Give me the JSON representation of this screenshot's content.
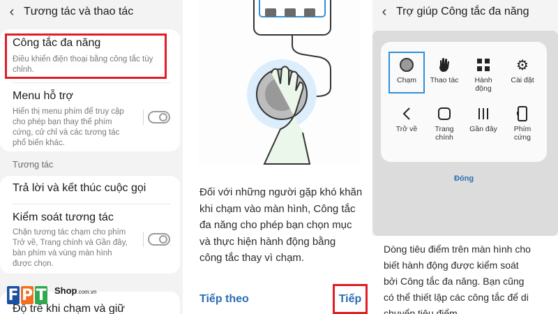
{
  "panel1": {
    "title": "Tương tác và thao tác",
    "items": [
      {
        "title": "Công tắc đa năng",
        "subtitle_lines": [
          "Điều khiển điện thoại bằng công tắc tùy",
          "chỉnh."
        ]
      },
      {
        "title": "Menu hỗ trợ",
        "subtitle_lines": [
          "Hiển thị menu phím để truy cập",
          "cho phép bạn thay thế phím",
          "cứng, cử chỉ và các tương tác",
          "phổ biến khác."
        ],
        "toggle": "off"
      },
      {
        "title": "Trả lời và kết thúc cuộc gọi"
      },
      {
        "title": "Kiểm soát tương tác",
        "subtitle_lines": [
          "Chặn tương tác chạm cho phím",
          "Trở về, Trang chính và Gần đây,",
          "bàn phím và vùng màn hình",
          "được chọn."
        ],
        "toggle": "off"
      },
      {
        "title": "Độ trễ khi chạm và giữ"
      }
    ],
    "section_label": "Tương tác",
    "logo": {
      "letters": [
        "F",
        "P",
        "T"
      ],
      "shop": "Shop",
      "domain": ".com.vn"
    }
  },
  "panel2": {
    "text_lines": [
      "Đối với những người gặp khó khăn",
      "khi chạm vào màn hình, Công tắc",
      "đa năng cho phép bạn chọn mục",
      "và thực hiện hành động bằng",
      "công tắc thay vì chạm."
    ],
    "next_label": "Tiếp theo",
    "go_label": "Tiếp"
  },
  "panel3": {
    "title": "Trợ giúp Công tắc đa năng",
    "grid": [
      {
        "label": "Chạm",
        "icon": "circle-icon"
      },
      {
        "label": "Thao tác",
        "icon": "hand-icon"
      },
      {
        "label": "Hành động",
        "icon": "grid-icon"
      },
      {
        "label": "Cài đặt",
        "icon": "gear-icon"
      },
      {
        "label": "Trở về",
        "icon": "back-icon"
      },
      {
        "label": "Trang chính",
        "icon": "home-icon"
      },
      {
        "label": "Gần đây",
        "icon": "recents-icon"
      },
      {
        "label": "Phím cứng",
        "icon": "phone-icon"
      }
    ],
    "close_label": "Đóng",
    "text_lines": [
      "Dòng tiêu điểm trên màn hình cho",
      "biết hành động được kiểm soát",
      "bởi Công tắc đa năng. Bạn cũng",
      "có thể thiết lập các công tắc để di",
      "chuyển tiêu điểm."
    ]
  },
  "colors": {
    "highlight": "#e31b23",
    "link": "#2c6db5",
    "select": "#2e8fd8"
  }
}
